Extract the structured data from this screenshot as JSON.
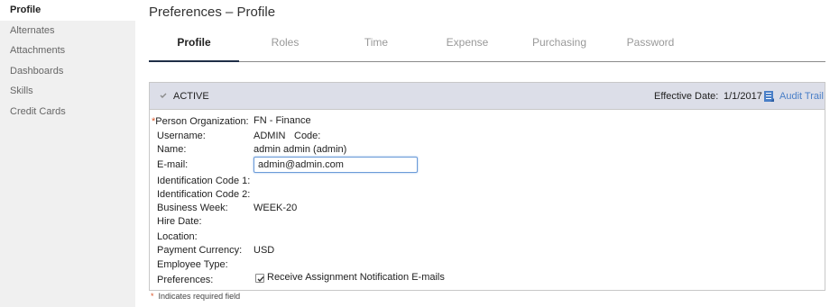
{
  "sidebar": {
    "items": [
      {
        "label": "Profile"
      },
      {
        "label": "Alternates"
      },
      {
        "label": "Attachments"
      },
      {
        "label": "Dashboards"
      },
      {
        "label": "Skills"
      },
      {
        "label": "Credit Cards"
      }
    ]
  },
  "page": {
    "title": "Preferences – Profile"
  },
  "tabs": [
    {
      "label": "Profile"
    },
    {
      "label": "Roles"
    },
    {
      "label": "Time"
    },
    {
      "label": "Expense"
    },
    {
      "label": "Purchasing"
    },
    {
      "label": "Password"
    }
  ],
  "panel": {
    "status": "ACTIVE",
    "effective_date_label": "Effective Date:",
    "effective_date_value": "1/1/2017",
    "audit_trail_label": "Audit Trail",
    "required_marker": "*",
    "fields": {
      "person_org": {
        "label": "Person Organization:",
        "value": "FN - Finance"
      },
      "username": {
        "label": "Username:",
        "value": "ADMIN",
        "code_label": "Code:"
      },
      "name": {
        "label": "Name:",
        "value": "admin admin (admin)"
      },
      "email": {
        "label": "E-mail:",
        "value": "admin@admin.com"
      },
      "id_code_1": {
        "label": "Identification Code 1:"
      },
      "id_code_2": {
        "label": "Identification Code 2:"
      },
      "business_week": {
        "label": "Business Week:",
        "value": "WEEK-20"
      },
      "hire_date": {
        "label": "Hire Date:"
      },
      "location": {
        "label": "Location:"
      },
      "payment_currency": {
        "label": "Payment Currency:",
        "value": "USD"
      },
      "employee_type": {
        "label": "Employee Type:"
      },
      "preferences": {
        "label": "Preferences:",
        "option_label": "Receive Assignment Notification E-mails",
        "checked": true
      }
    }
  },
  "footer": {
    "required_marker": "*",
    "required_note": "Indicates required field"
  },
  "colors": {
    "link": "#4a7fc7",
    "required": "#d9582b",
    "panel_header": "#dcdee8",
    "active_tab_underline": "#1f2e46"
  }
}
